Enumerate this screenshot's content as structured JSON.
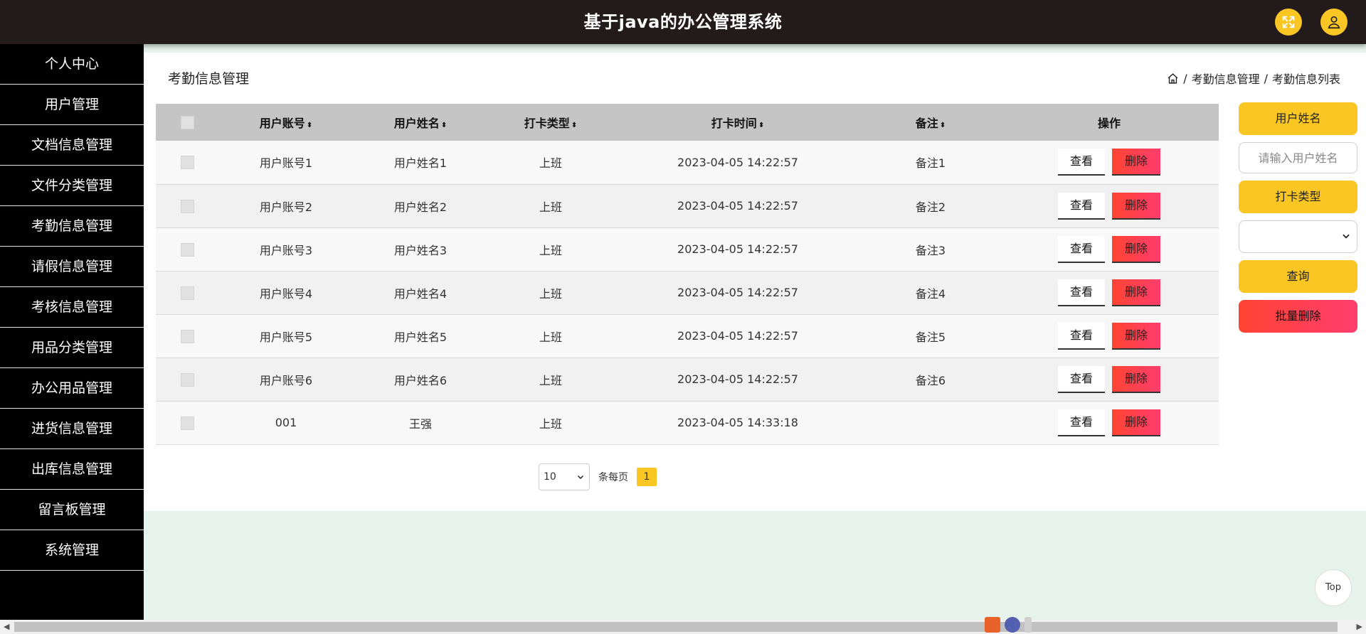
{
  "header": {
    "title": "基于java的办公管理系统",
    "fullscreen_icon": "expand-icon",
    "user_icon": "user-icon"
  },
  "sidebar": {
    "items": [
      {
        "label": "个人中心"
      },
      {
        "label": "用户管理"
      },
      {
        "label": "文档信息管理"
      },
      {
        "label": "文件分类管理"
      },
      {
        "label": "考勤信息管理"
      },
      {
        "label": "请假信息管理"
      },
      {
        "label": "考核信息管理"
      },
      {
        "label": "用品分类管理"
      },
      {
        "label": "办公用品管理"
      },
      {
        "label": "进货信息管理"
      },
      {
        "label": "出库信息管理"
      },
      {
        "label": "留言板管理"
      },
      {
        "label": "系统管理"
      }
    ]
  },
  "main": {
    "title": "考勤信息管理",
    "breadcrumb": {
      "home_icon": "home-icon",
      "sep1": "/",
      "item1": "考勤信息管理",
      "sep2": "/",
      "item2": "考勤信息列表"
    },
    "table": {
      "headers": {
        "account": "用户账号",
        "name": "用户姓名",
        "type": "打卡类型",
        "time": "打卡时间",
        "remark": "备注",
        "ops": "操作"
      },
      "sort_glyph": "⬍",
      "view_label": "查看",
      "delete_label": "删除",
      "rows": [
        {
          "account": "用户账号1",
          "name": "用户姓名1",
          "type": "上班",
          "time": "2023-04-05 14:22:57",
          "remark": "备注1"
        },
        {
          "account": "用户账号2",
          "name": "用户姓名2",
          "type": "上班",
          "time": "2023-04-05 14:22:57",
          "remark": "备注2"
        },
        {
          "account": "用户账号3",
          "name": "用户姓名3",
          "type": "上班",
          "time": "2023-04-05 14:22:57",
          "remark": "备注3"
        },
        {
          "account": "用户账号4",
          "name": "用户姓名4",
          "type": "上班",
          "time": "2023-04-05 14:22:57",
          "remark": "备注4"
        },
        {
          "account": "用户账号5",
          "name": "用户姓名5",
          "type": "上班",
          "time": "2023-04-05 14:22:57",
          "remark": "备注5"
        },
        {
          "account": "用户账号6",
          "name": "用户姓名6",
          "type": "上班",
          "time": "2023-04-05 14:22:57",
          "remark": "备注6"
        },
        {
          "account": "001",
          "name": "王强",
          "type": "上班",
          "time": "2023-04-05 14:33:18",
          "remark": ""
        }
      ]
    },
    "pager": {
      "page_size": "10",
      "per_page_label": "条每页",
      "current_page": "1"
    }
  },
  "search_panel": {
    "name_label": "用户姓名",
    "name_placeholder": "请输入用户姓名",
    "type_label": "打卡类型",
    "type_value": "",
    "query_button": "查询",
    "batch_delete_button": "批量删除"
  },
  "top_button": "Top",
  "colors": {
    "header_bg": "#231a1c",
    "sidebar_bg": "#000000",
    "accent": "#f9c623",
    "danger": "#ff4433",
    "page_bg": "#e6f2ec"
  }
}
